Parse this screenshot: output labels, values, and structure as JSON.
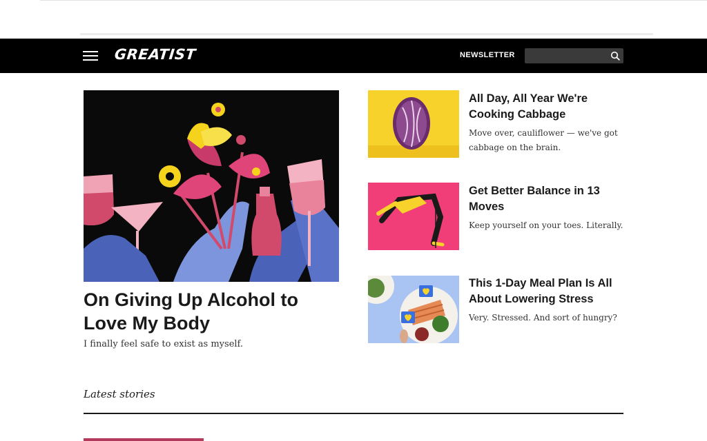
{
  "header": {
    "logo": "GREATIST",
    "newsletter_label": "NEWSLETTER",
    "search_placeholder": "",
    "colors": {
      "bar": "#000000",
      "search_bg": "#3a3a3a"
    },
    "icons": {
      "menu": "hamburger-menu-icon",
      "search": "search-icon"
    }
  },
  "featured": {
    "title": "On Giving Up Alcohol to Love My Body",
    "subtitle": "I finally feel safe to exist as myself."
  },
  "cards": [
    {
      "title": "All Day, All Year We're Cooking Cabbage",
      "subtitle": "Move over, cauliflower — we've got cabbage on the brain."
    },
    {
      "title": "Get Better Balance in 13 Moves",
      "subtitle": "Keep yourself on your toes. Literally."
    },
    {
      "title": "This 1-Day Meal Plan Is All About Lowering Stress",
      "subtitle": "Very. Stressed. And sort of hungry?"
    }
  ],
  "latest": {
    "heading": "Latest stories"
  }
}
